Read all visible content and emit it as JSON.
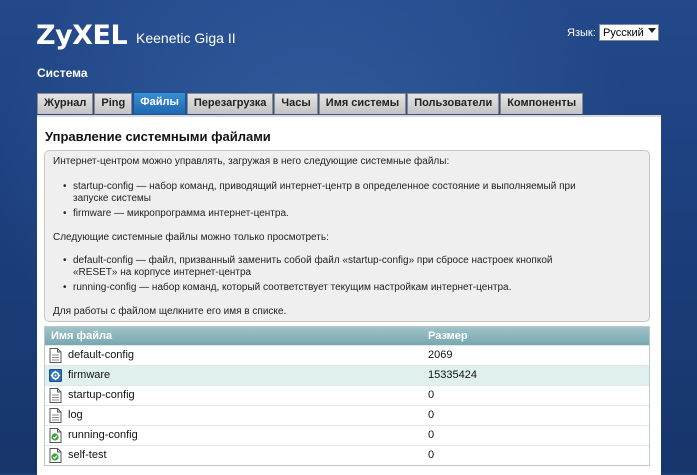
{
  "brand": {
    "logo": "ZyXEL",
    "model": "Keenetic Giga II"
  },
  "language": {
    "label": "Язык:",
    "selected": "Русский"
  },
  "page_title": "Система",
  "tabs": [
    {
      "label": "Журнал"
    },
    {
      "label": "Ping"
    },
    {
      "label": "Файлы",
      "active": true
    },
    {
      "label": "Перезагрузка"
    },
    {
      "label": "Часы"
    },
    {
      "label": "Имя системы"
    },
    {
      "label": "Пользователи"
    },
    {
      "label": "Компоненты"
    }
  ],
  "panel": {
    "heading": "Управление системными файлами",
    "info": {
      "intro": "Интернет-центром можно управлять, загружая в него следующие системные файлы:",
      "upload_items": [
        "startup-config — набор команд, приводящий интернет-центр в определенное состояние и выполняемый при",
        "запуске системы",
        "firmware — микропрограмма интернет-центра."
      ],
      "view_intro": "Следующие системные файлы можно только просмотреть:",
      "view_items": [
        "default-config — файл, призванный заменить собой файл «startup-config» при сбросе настроек кнопкой",
        "«RESET» на корпусе интернет-центра",
        "running-config — набор команд, который соответствует текущим настройкам интернет-центра."
      ],
      "hint": "Для работы с файлом щелкните его имя в списке."
    },
    "table": {
      "col_name": "Имя файла",
      "col_size": "Размер",
      "rows": [
        {
          "icon": "document-icon",
          "name": "default-config",
          "size": "2069"
        },
        {
          "icon": "gear-icon",
          "name": "firmware",
          "size": "15335424"
        },
        {
          "icon": "document-icon",
          "name": "startup-config",
          "size": "0"
        },
        {
          "icon": "document-icon",
          "name": "log",
          "size": "0"
        },
        {
          "icon": "green-document-icon",
          "name": "running-config",
          "size": "0"
        },
        {
          "icon": "green-document-icon",
          "name": "self-test",
          "size": "0"
        }
      ]
    }
  }
}
